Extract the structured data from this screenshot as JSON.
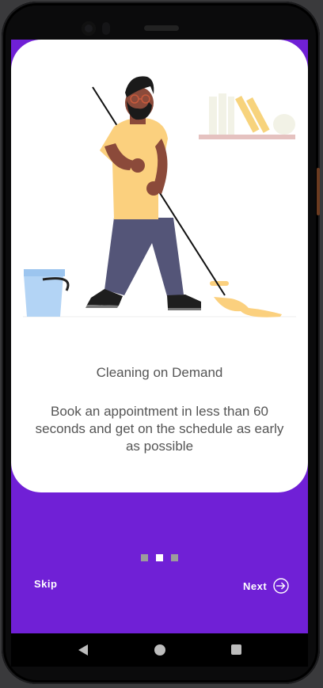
{
  "onboarding": {
    "title": "Cleaning on Demand",
    "description": "Book an appointment in less than 60 seconds and get on the schedule as early as possible",
    "page_indicator": {
      "total": 3,
      "active_index": 1
    },
    "skip_label": "Skip",
    "next_label": "Next"
  },
  "colors": {
    "accent": "#7020d6",
    "card": "#ffffff",
    "text": "#555555",
    "dot_inactive": "#9c9c9c",
    "dot_active": "#ffffff"
  },
  "illustration": {
    "icon": "person-mopping-illustration"
  },
  "navigation_bar": {
    "back_icon": "triangle-back-icon",
    "home_icon": "circle-home-icon",
    "recents_icon": "square-recents-icon"
  }
}
